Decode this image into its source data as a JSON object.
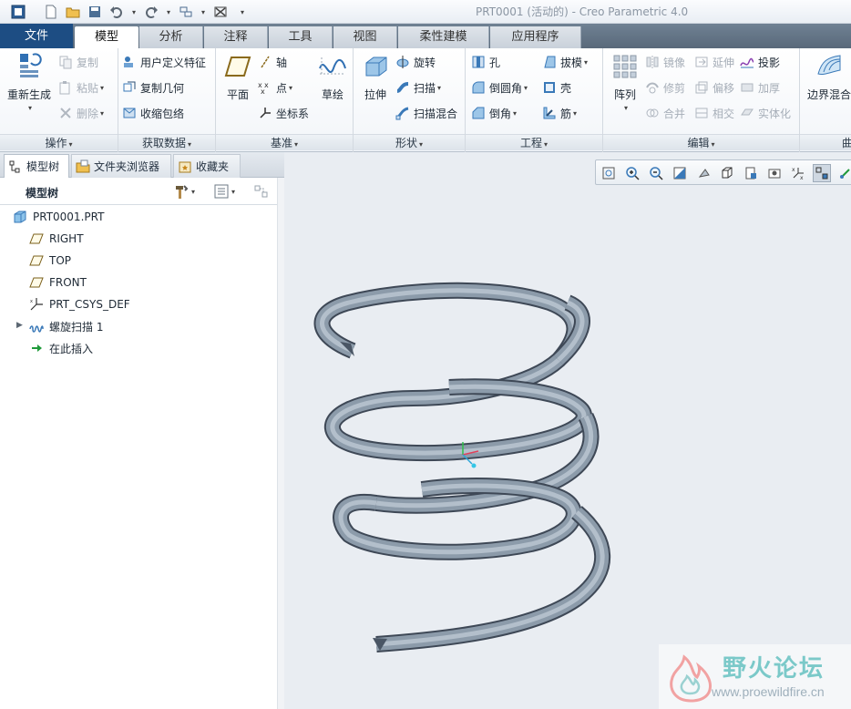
{
  "window": {
    "title": "PRT0001 (活动的) - Creo Parametric 4.0"
  },
  "quick_access": [
    "app-icon",
    "new-icon",
    "open-icon",
    "save-icon",
    "undo-icon",
    "redo-icon",
    "regenerate-icon",
    "close-window-icon",
    "customize-icon"
  ],
  "tabs": [
    {
      "label": "文件",
      "state": "file"
    },
    {
      "label": "模型",
      "state": "active"
    },
    {
      "label": "分析",
      "state": "normal"
    },
    {
      "label": "注释",
      "state": "normal"
    },
    {
      "label": "工具",
      "state": "normal"
    },
    {
      "label": "视图",
      "state": "normal"
    },
    {
      "label": "柔性建模",
      "state": "normal"
    },
    {
      "label": "应用程序",
      "state": "normal"
    }
  ],
  "ribbon": {
    "groups": {
      "operations": {
        "label": "操作",
        "regenerate": "重新生成",
        "copy": "复制",
        "paste": "粘贴",
        "delete": "删除"
      },
      "get_data": {
        "label": "获取数据",
        "udf": "用户定义特征",
        "copy_geom": "复制几何",
        "shrinkwrap": "收缩包络"
      },
      "datum": {
        "label": "基准",
        "plane": "平面",
        "axis": "轴",
        "point": "点",
        "csys": "坐标系",
        "sketch": "草绘"
      },
      "shapes": {
        "label": "形状",
        "extrude": "拉伸",
        "revolve": "旋转",
        "sweep": "扫描",
        "swept_blend": "扫描混合"
      },
      "engineering": {
        "label": "工程",
        "hole": "孔",
        "round": "倒圆角",
        "chamfer": "倒角",
        "draft": "拔模",
        "shell": "壳",
        "rib": "筋"
      },
      "editing": {
        "label": "编辑",
        "pattern": "阵列",
        "mirror": "镜像",
        "extend": "延伸",
        "project": "投影",
        "trim": "修剪",
        "offset": "偏移",
        "thicken": "加厚",
        "merge": "合并",
        "intersect": "相交",
        "solidify": "实体化"
      },
      "surfaces": {
        "label": "曲",
        "boundary_blend": "边界混合"
      }
    }
  },
  "left_panel": {
    "tabs": [
      {
        "label": "模型树",
        "icon": "model-tree-icon",
        "active": true
      },
      {
        "label": "文件夹浏览器",
        "icon": "folder-browser-icon",
        "active": false
      },
      {
        "label": "收藏夹",
        "icon": "favorites-icon",
        "active": false
      }
    ],
    "tree_title": "模型树",
    "tree": [
      {
        "label": "PRT0001.PRT",
        "icon": "part-icon"
      },
      {
        "label": "RIGHT",
        "icon": "datum-plane-icon"
      },
      {
        "label": "TOP",
        "icon": "datum-plane-icon"
      },
      {
        "label": "FRONT",
        "icon": "datum-plane-icon"
      },
      {
        "label": "PRT_CSYS_DEF",
        "icon": "csys-icon"
      },
      {
        "label": "螺旋扫描 1",
        "icon": "helical-sweep-icon",
        "expandable": true
      },
      {
        "label": "在此插入",
        "icon": "insert-here-arrow-icon"
      }
    ]
  },
  "viewport": {
    "toolbar": [
      "refit-icon",
      "zoom-in-icon",
      "zoom-out-icon",
      "repaint-icon",
      "display-style-icon",
      "saved-orientations-icon",
      "view-manager-icon",
      "perspective-icon",
      "datum-display-icon",
      "spin-center-icon",
      "annotation-display-icon"
    ],
    "model": "helical-spring"
  },
  "watermark": {
    "title": "野火论坛",
    "url": "www.proewildfire.cn"
  },
  "colors": {
    "file_tab": "#1d4d83",
    "tab_bar": "#5f7083",
    "spring_fill": "#8c9baa",
    "spring_dark": "#4a5665",
    "viewport_bg": "#e9edf2"
  }
}
